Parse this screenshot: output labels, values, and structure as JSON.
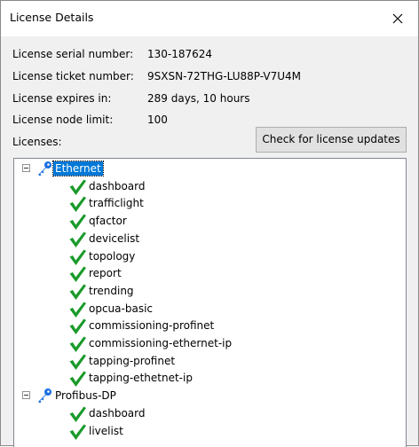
{
  "window": {
    "title": "License Details"
  },
  "info": [
    {
      "label": "License serial number:",
      "value": "130-187624"
    },
    {
      "label": "License ticket number:",
      "value": "9SXSN-72THG-LU88P-V7U4M"
    },
    {
      "label": "License expires in:",
      "value": "289 days, 10 hours"
    },
    {
      "label": "License node limit:",
      "value": "100"
    }
  ],
  "licenses_label": "Licenses:",
  "update_button": "Check for license updates",
  "tree": {
    "groups": [
      {
        "name": "Ethernet",
        "selected": true,
        "items": [
          "dashboard",
          "trafficlight",
          "qfactor",
          "devicelist",
          "topology",
          "report",
          "trending",
          "opcua-basic",
          "commissioning-profinet",
          "commissioning-ethernet-ip",
          "tapping-profinet",
          "tapping-ethetnet-ip"
        ]
      },
      {
        "name": "Profibus-DP",
        "selected": false,
        "items": [
          "dashboard",
          "livelist"
        ]
      }
    ]
  },
  "colors": {
    "key": "#1a6fe0",
    "check": "#1a9a2a",
    "selection": "#0078d7"
  }
}
